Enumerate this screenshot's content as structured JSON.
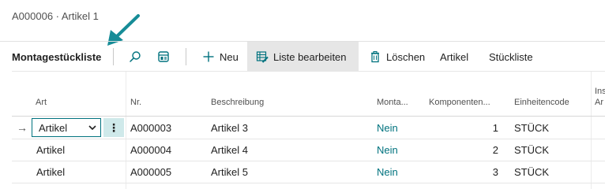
{
  "breadcrumb": "A000006 · Artikel 1",
  "toolbar": {
    "title": "Montagestückliste",
    "new_label": "Neu",
    "edit_list_label": "Liste bearbeiten",
    "delete_label": "Löschen",
    "item_label": "Artikel",
    "bom_label": "Stückliste"
  },
  "columns": {
    "art": "Art",
    "nr": "Nr.",
    "beschreibung": "Beschreibung",
    "montage": "Monta...",
    "komponenten": "Komponenten...",
    "einheit": "Einheitencode",
    "ins_1": "Ins",
    "ins_2": "Ar"
  },
  "rows": [
    {
      "art": "Artikel",
      "nr": "A000003",
      "beschreibung": "Artikel 3",
      "montage": "Nein",
      "komponenten": "1",
      "einheit": "STÜCK"
    },
    {
      "art": "Artikel",
      "nr": "A000004",
      "beschreibung": "Artikel 4",
      "montage": "Nein",
      "komponenten": "2",
      "einheit": "STÜCK"
    },
    {
      "art": "Artikel",
      "nr": "A000005",
      "beschreibung": "Artikel 5",
      "montage": "Nein",
      "komponenten": "3",
      "einheit": "STÜCK"
    }
  ],
  "colors": {
    "accent": "#00727e",
    "arrow": "#168c97",
    "active_toolbar_bg": "#e6e6e6",
    "row_menu_bg": "#cfe9ea"
  }
}
